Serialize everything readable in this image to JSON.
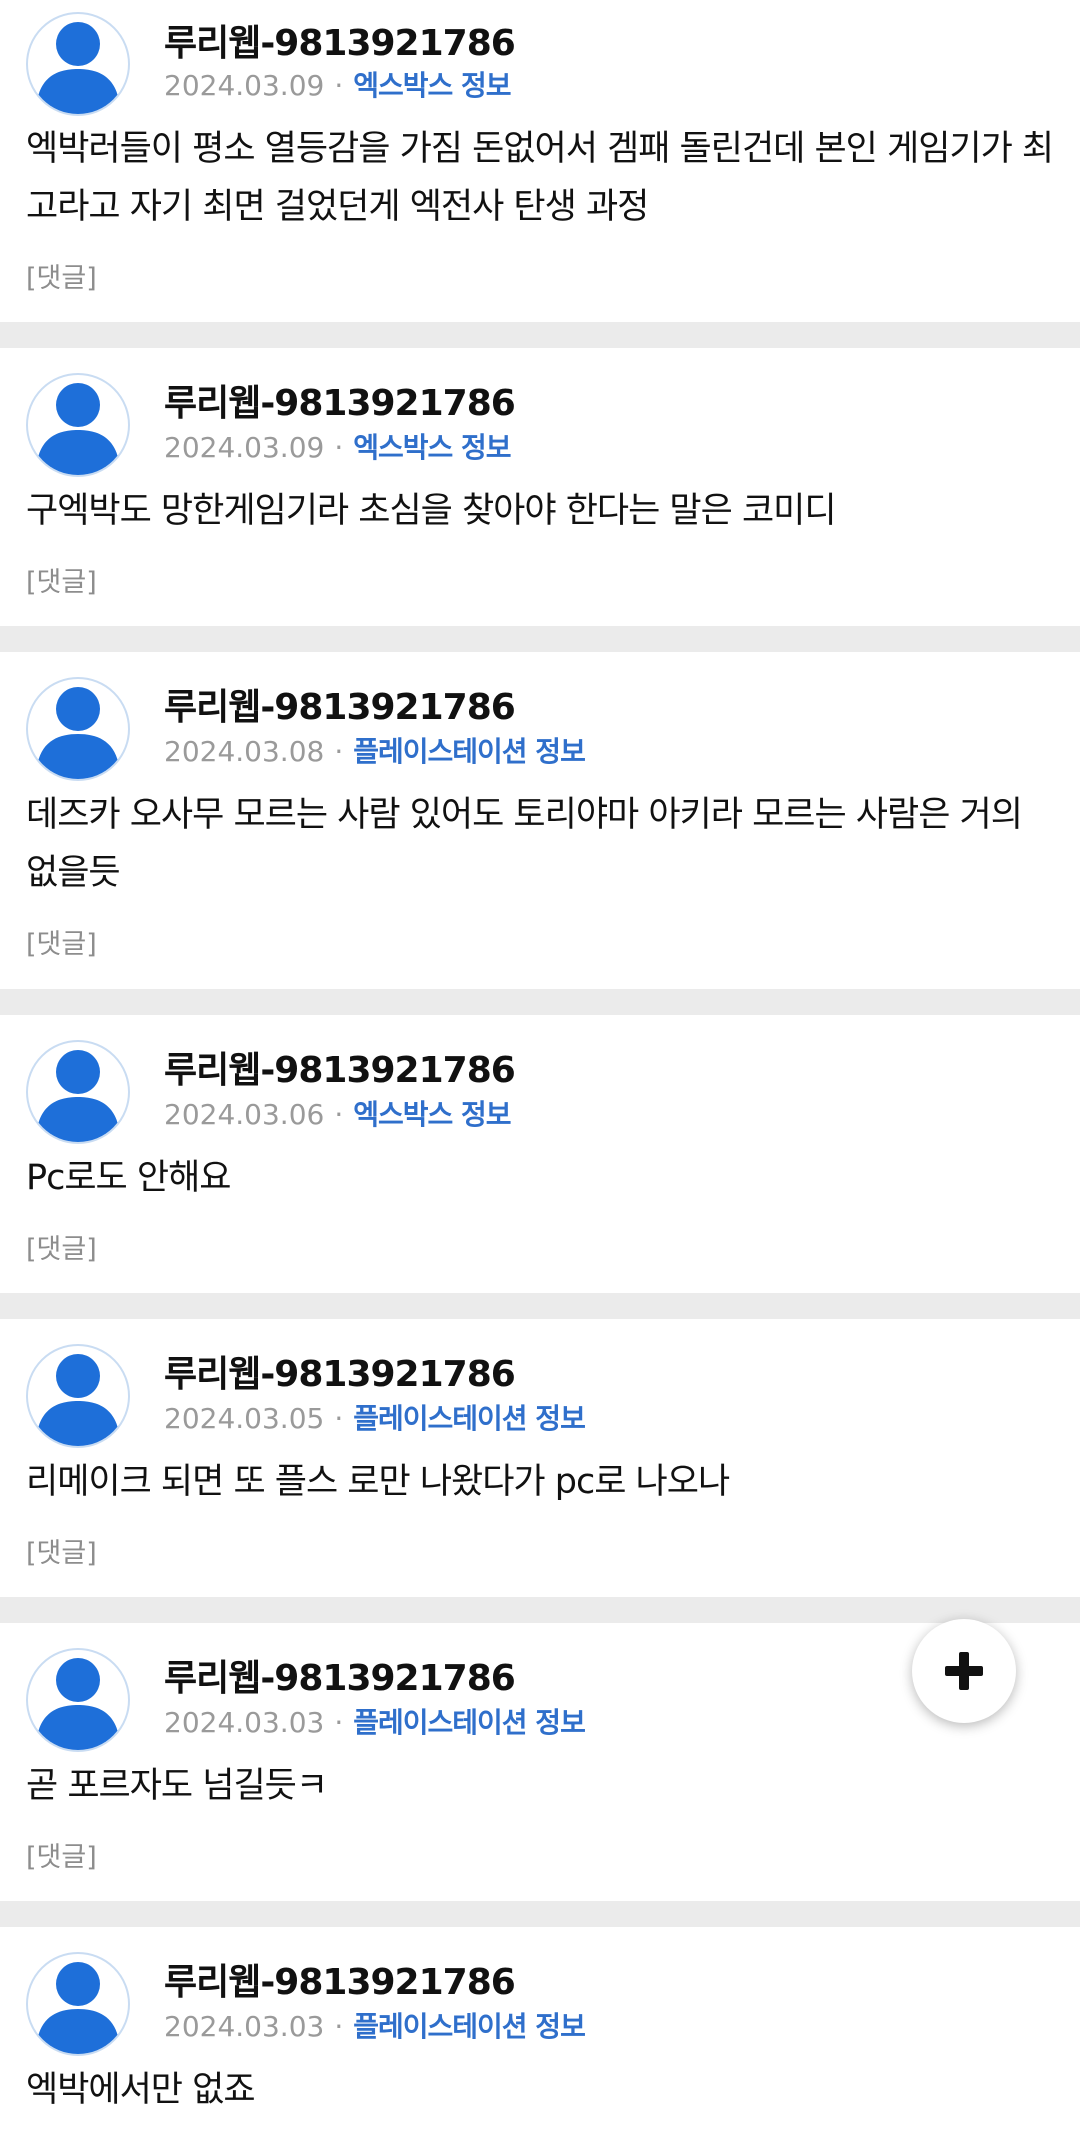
{
  "posts": [
    {
      "author": "루리웹-9813921786",
      "date": "2024.03.09",
      "separator": "·",
      "board": "엑스박스 정보",
      "content": "엑박러들이 평소 열등감을 가짐 돈없어서 겜패 돌린건데 본인 게임기가 최고라고 자기 최면 걸었던게 엑전사 탄생 과정",
      "reply_label": "[댓글]"
    },
    {
      "author": "루리웹-9813921786",
      "date": "2024.03.09",
      "separator": "·",
      "board": "엑스박스 정보",
      "content": "구엑박도 망한게임기라 초심을 찾아야 한다는 말은 코미디",
      "reply_label": "[댓글]"
    },
    {
      "author": "루리웹-9813921786",
      "date": "2024.03.08",
      "separator": "·",
      "board": "플레이스테이션 정보",
      "content": "데즈카 오사무 모르는 사람 있어도 토리야마 아키라 모르는 사람은 거의 없을듯",
      "reply_label": "[댓글]"
    },
    {
      "author": "루리웹-9813921786",
      "date": "2024.03.06",
      "separator": "·",
      "board": "엑스박스 정보",
      "content": "Pc로도 안해요",
      "reply_label": "[댓글]"
    },
    {
      "author": "루리웹-9813921786",
      "date": "2024.03.05",
      "separator": "·",
      "board": "플레이스테이션 정보",
      "content": "리메이크 되면 또 플스 로만 나왔다가 pc로 나오나",
      "reply_label": "[댓글]"
    },
    {
      "author": "루리웹-9813921786",
      "date": "2024.03.03",
      "separator": "·",
      "board": "플레이스테이션 정보",
      "content": "곧 포르자도 넘길듯ㅋ",
      "reply_label": "[댓글]"
    },
    {
      "author": "루리웹-9813921786",
      "date": "2024.03.03",
      "separator": "·",
      "board": "플레이스테이션 정보",
      "content": "엑박에서만 없죠",
      "reply_label": ""
    }
  ],
  "fab": {
    "icon": "plus-icon"
  },
  "colors": {
    "board_link": "#2f6fcb",
    "avatar": "#1e6fd9",
    "separator_bg": "#ebebeb",
    "date": "#9a9a9a"
  }
}
